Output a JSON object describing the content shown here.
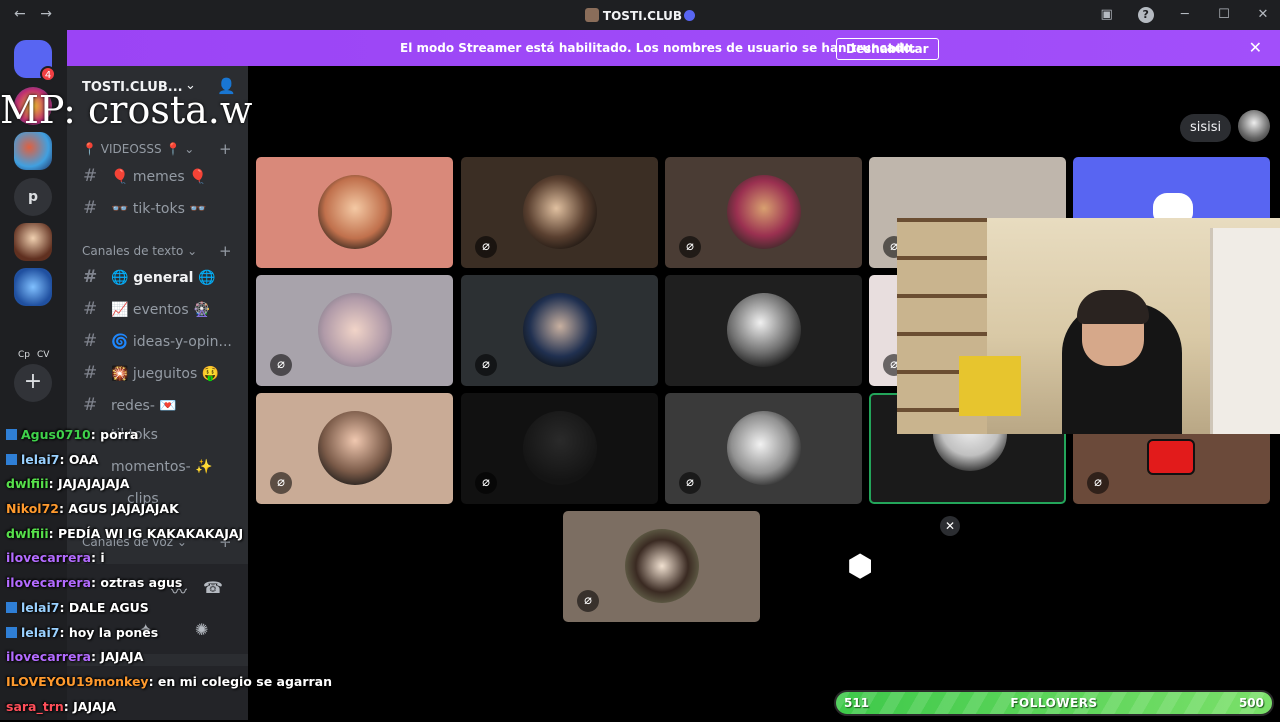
{
  "titlebar": {
    "title": "TOSTI.CLUB",
    "back": "←",
    "forward": "→",
    "help": "?",
    "minimize": "─",
    "maximize": "☐",
    "close": "✕"
  },
  "servers": {
    "badge": "4",
    "letter_p": "p",
    "label_cp": "Cp",
    "label_cv": "CV",
    "add": "+"
  },
  "banner": {
    "message": "El modo Streamer está habilitado. Los nombres de usuario se han truncado.",
    "button": "Deshabilitar",
    "close": "✕"
  },
  "guild": {
    "name": "TOSTI.CLUB..."
  },
  "categories": {
    "videos": "📍 VIDEOSSS 📍",
    "text": "Canales de texto",
    "voice": "Canales de voz"
  },
  "channels": [
    {
      "name": "🎈 memes 🎈"
    },
    {
      "name": "👓 tik-toks 👓"
    },
    {
      "name": "🌐 general 🌐"
    },
    {
      "name": "📈 eventos 🎡"
    },
    {
      "name": "🌀 ideas-y-opin..."
    },
    {
      "name": "🎇 jueguitos 🤑"
    },
    {
      "name": "redes- 💌"
    },
    {
      "name": "tiktoks"
    },
    {
      "name": "momentos- ✨"
    },
    {
      "name": "clips"
    }
  ],
  "overlay": {
    "mp": "MP: crosta.w"
  },
  "chat": [
    {
      "user": "Agus0710",
      "text": ": porra",
      "color": "#3fd14b",
      "badge": true
    },
    {
      "user": "lelai7",
      "text": ": OAA",
      "color": "#9ad1ff",
      "badge": true
    },
    {
      "user": "dwlfiii",
      "text": ": JAJAJAJAJA",
      "color": "#57e04b",
      "badge": false
    },
    {
      "user": "Nikol72",
      "text": ": AGUS JAJAJAJAK",
      "color": "#ff9a2e",
      "badge": false
    },
    {
      "user": "dwlfiii",
      "text": ": PEDÍA WI IG KAKAKAKAJAJ",
      "color": "#57e04b",
      "badge": false
    },
    {
      "user": "ilovecarrera",
      "text": ": i",
      "color": "#b36bff",
      "badge": false
    },
    {
      "user": "ilovecarrera",
      "text": ": oztras agus",
      "color": "#b36bff",
      "badge": false
    },
    {
      "user": "lelai7",
      "text": ": DALE AGUS",
      "color": "#9ad1ff",
      "badge": true
    },
    {
      "user": "lelai7",
      "text": ": hoy la pones",
      "color": "#9ad1ff",
      "badge": true
    },
    {
      "user": "ilovecarrera",
      "text": ": JAJAJA",
      "color": "#b36bff",
      "badge": false
    },
    {
      "user": "ILOVEYOU19monkey",
      "text": ": en mi colegio se agarran",
      "color": "#ff9a2e",
      "badge": false
    },
    {
      "user": "sara_trn",
      "text": ": JAJAJA",
      "color": "#ff4f5a",
      "badge": false
    }
  ],
  "stage": {
    "user_pill": "sisisi",
    "mute_icon": "🎙",
    "tile_close": "✕",
    "shapes": "⬢"
  },
  "followers": {
    "current": "511",
    "label": "FOLLOWERS",
    "goal": "500"
  },
  "colors": {
    "banner": "#a24ffa",
    "accent": "#5865f2",
    "speaking": "#23a55a"
  }
}
